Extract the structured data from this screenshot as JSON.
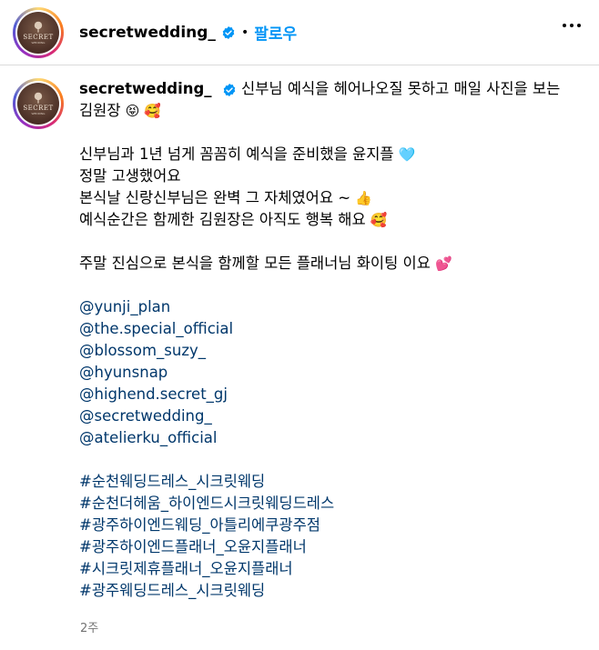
{
  "header": {
    "username": "secretwedding_",
    "separator": "•",
    "follow_label": "팔로우",
    "more_icon": "more-horizontal-icon"
  },
  "avatar": {
    "logo_text": "SECRET",
    "logo_sub": "WEDDING"
  },
  "post": {
    "username": "secretwedding_",
    "line1_text": "신부님 예식을 헤어나오질 못하고 매일 사진을 보는 김원장",
    "line1_emoji": "😝 🥰",
    "para2": [
      {
        "text": "신부님과 1년 넘게 꼼꼼히 예식을 준비했을 윤지플",
        "emoji": "🩵"
      },
      {
        "text": "정말 고생했어요",
        "emoji": ""
      },
      {
        "text": "본식날 신랑신부님은 완벽 그 자체였어요 ~",
        "emoji": "👍"
      },
      {
        "text": "예식순간은 함께한 김원장은 아직도 행복 해요",
        "emoji": "🥰"
      }
    ],
    "para3": {
      "text": "주말 진심으로 본식을 함께할 모든 플래너님 화이팅 이요",
      "emoji": "💕"
    },
    "mentions": [
      "@yunji_plan",
      "@the.special_official",
      "@blossom_suzy_",
      "@hyunsnap",
      "@highend.secret_gj",
      "@secretwedding_",
      "@atelierku_official"
    ],
    "hashtags": [
      "#순천웨딩드레스_시크릿웨딩",
      "#순천더헤움_하이엔드시크릿웨딩드레스",
      "#광주하이엔드웨딩_아틀리에쿠광주점",
      "#광주하이엔드플래너_오윤지플래너",
      "#시크릿제휴플래너_오윤지플래너",
      "#광주웨딩드레스_시크릿웨딩"
    ],
    "timestamp": "2주"
  },
  "colors": {
    "link": "#00376b",
    "follow": "#0095f6",
    "verified": "#0095f6",
    "muted": "#737373"
  }
}
